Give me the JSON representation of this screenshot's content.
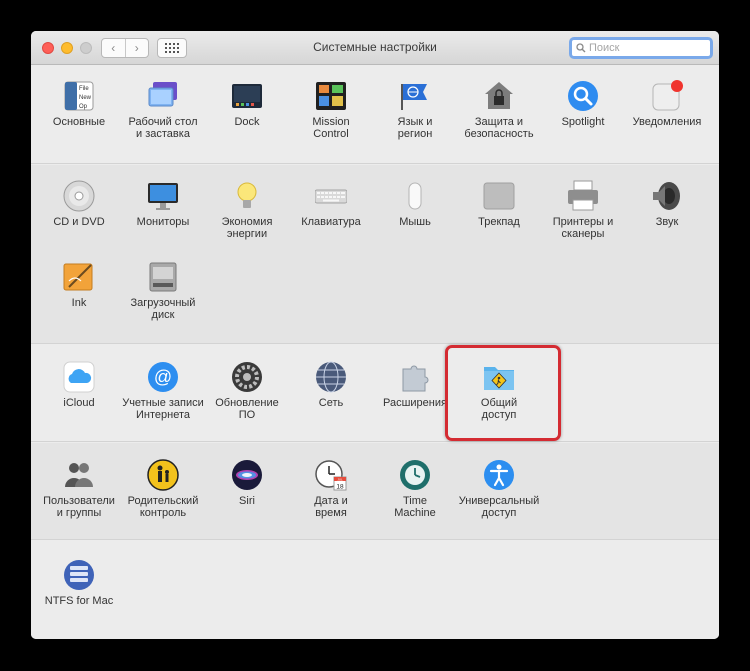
{
  "window": {
    "title": "Системные настройки"
  },
  "toolbar": {
    "back": "‹",
    "forward": "›"
  },
  "search": {
    "placeholder": "Поиск"
  },
  "panes": {
    "general": "Основные",
    "desktop": "Рабочий стол\nи заставка",
    "dock": "Dock",
    "mission_control": "Mission\nControl",
    "language": "Язык и\nрегион",
    "security": "Защита и\nбезопасность",
    "spotlight": "Spotlight",
    "notifications": "Уведомления",
    "cd_dvd": "CD и DVD",
    "displays": "Мониторы",
    "energy": "Экономия\nэнергии",
    "keyboard": "Клавиатура",
    "mouse": "Мышь",
    "trackpad": "Трекпад",
    "printers": "Принтеры и\nсканеры",
    "sound": "Звук",
    "ink": "Ink",
    "startup_disk": "Загрузочный\nдиск",
    "icloud": "iCloud",
    "internet_accounts": "Учетные записи\nИнтернета",
    "software_update": "Обновление\nПО",
    "network": "Сеть",
    "extensions": "Расширения",
    "sharing": "Общий\nдоступ",
    "users": "Пользователи\nи группы",
    "parental": "Родительский\nконтроль",
    "siri": "Siri",
    "date_time": "Дата и\nвремя",
    "time_machine": "Time\nMachine",
    "accessibility": "Универсальный\nдоступ",
    "ntfs": "NTFS for Mac"
  },
  "icon_text": {
    "general_file": "File",
    "general_new": "New",
    "general_op": "Op",
    "calendar_month": "JUL",
    "calendar_day": "18"
  },
  "colors": {
    "highlight": "#d42b32",
    "search_focus": "#7aa9ea"
  }
}
